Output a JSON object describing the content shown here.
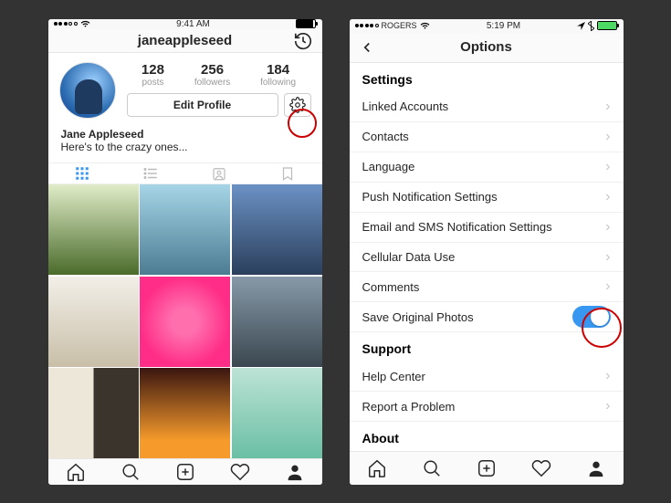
{
  "left": {
    "status": {
      "carrier": "",
      "time": "9:41 AM"
    },
    "nav": {
      "title": "janeappleseed"
    },
    "stats": {
      "posts": {
        "num": "128",
        "label": "posts"
      },
      "followers": {
        "num": "256",
        "label": "followers"
      },
      "following": {
        "num": "184",
        "label": "following"
      }
    },
    "edit_profile": "Edit Profile",
    "bio": {
      "name": "Jane Appleseed",
      "text": "Here's to the crazy ones..."
    }
  },
  "right": {
    "status": {
      "carrier": "ROGERS",
      "time": "5:19 PM"
    },
    "nav": {
      "title": "Options"
    },
    "sections": {
      "settings": {
        "header": "Settings",
        "items": {
          "linked": "Linked Accounts",
          "contacts": "Contacts",
          "language": "Language",
          "push": "Push Notification Settings",
          "email": "Email and SMS Notification Settings",
          "cellular": "Cellular Data Use",
          "comments": "Comments",
          "save": "Save Original Photos"
        }
      },
      "support": {
        "header": "Support",
        "items": {
          "help": "Help Center",
          "report": "Report a Problem"
        }
      },
      "about": {
        "header": "About"
      }
    }
  }
}
